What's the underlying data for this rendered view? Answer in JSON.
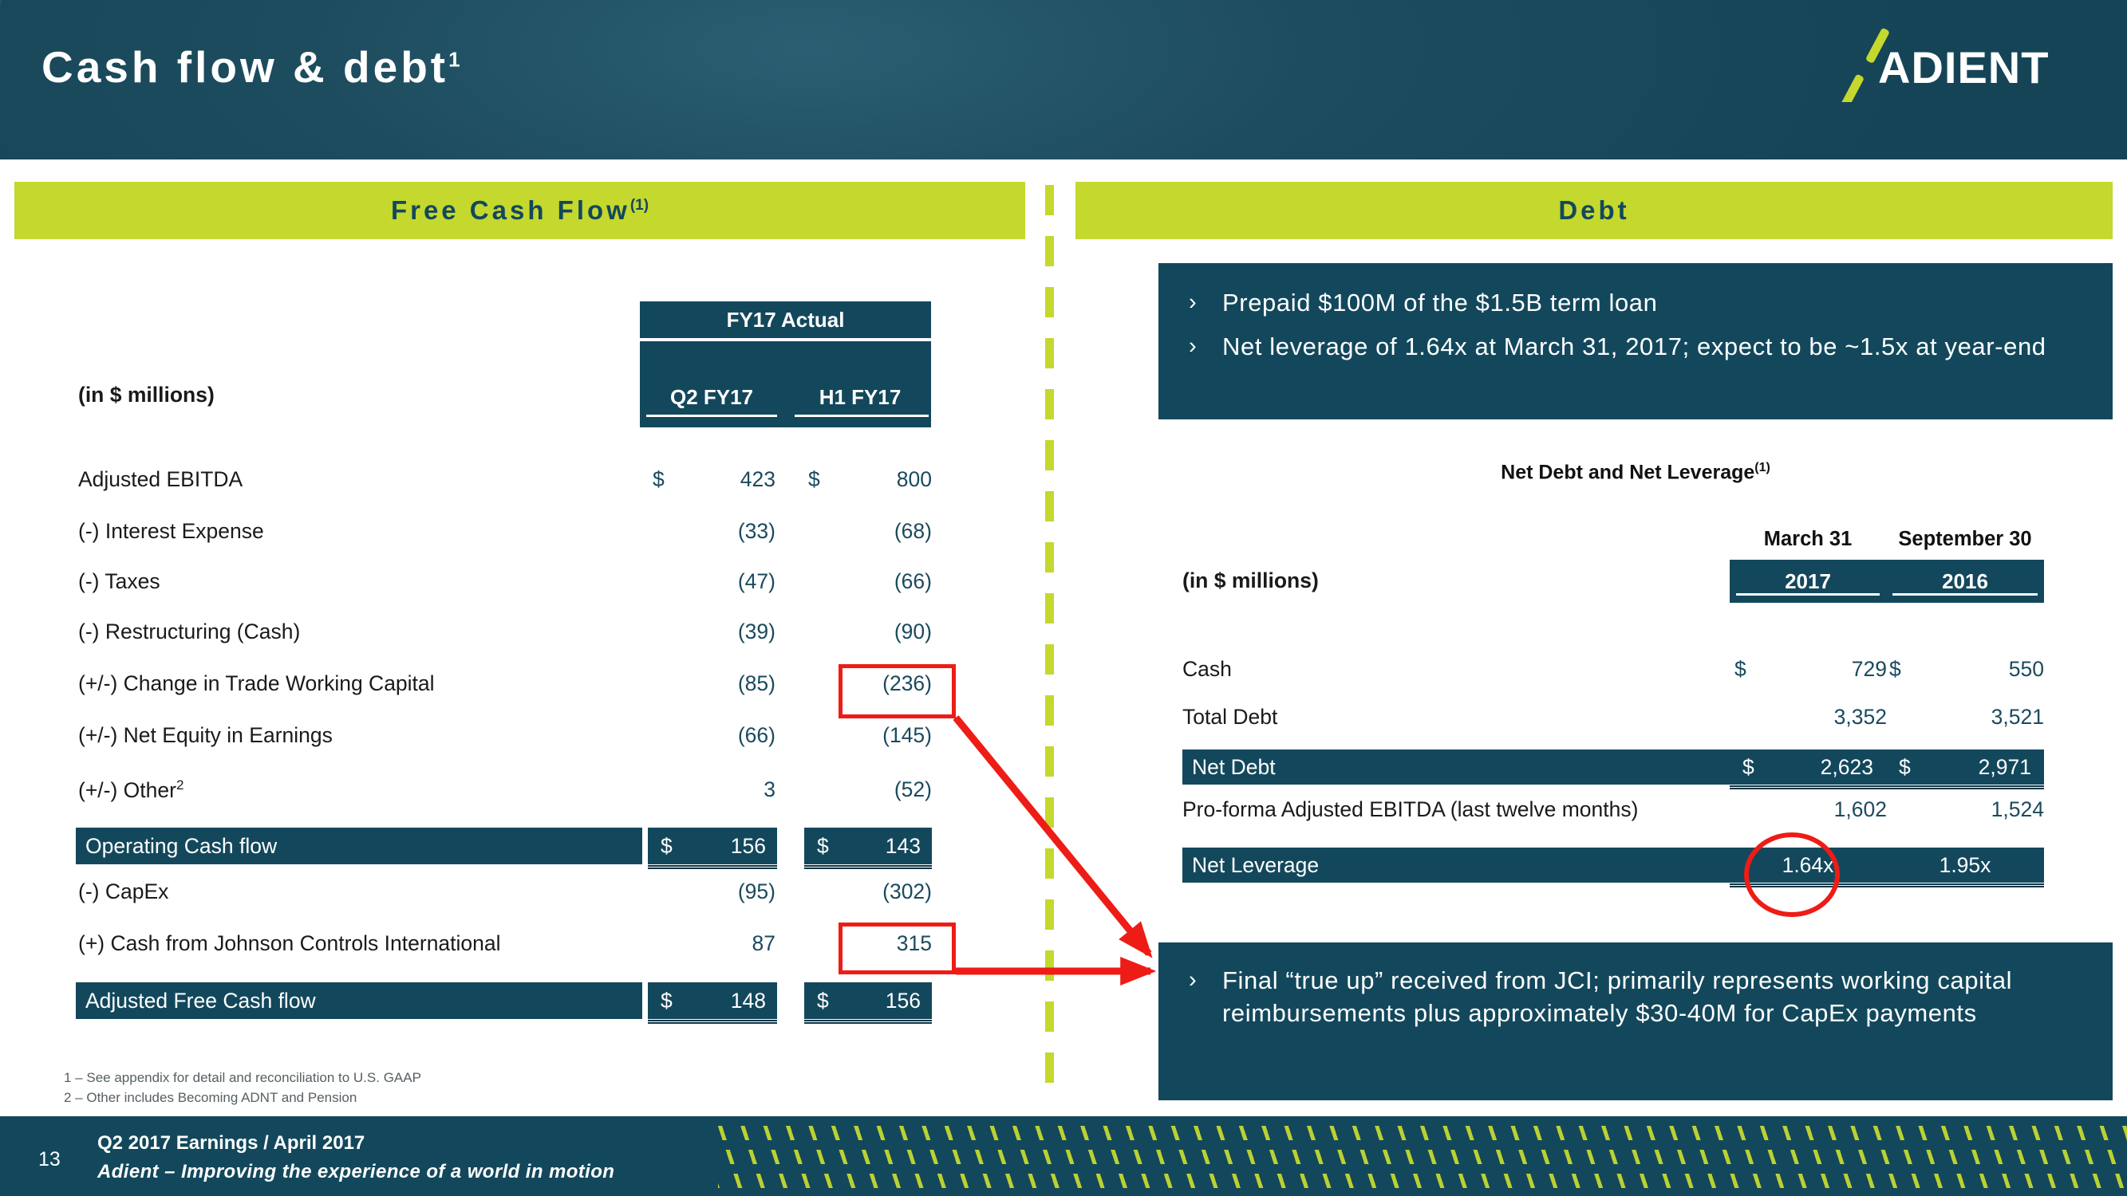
{
  "header": {
    "title": "Cash flow & debt",
    "title_sup": "1",
    "logo_text": "ADIENT"
  },
  "left_panel": {
    "bar_title": "Free Cash Flow",
    "bar_title_sup": "(1)",
    "table": {
      "group_header": "FY17 Actual",
      "column_headers": [
        "Q2 FY17",
        "H1 FY17"
      ],
      "units_label": "(in $ millions)",
      "rows": [
        {
          "label": "Adjusted EBITDA",
          "q2_dollar": "$",
          "q2": "423",
          "h1_dollar": "$",
          "h1": "800",
          "highlight": false
        },
        {
          "label": "(-) Interest Expense",
          "q2_dollar": "",
          "q2": "(33)",
          "h1_dollar": "",
          "h1": "(68)",
          "highlight": false
        },
        {
          "label": "(-) Taxes",
          "q2_dollar": "",
          "q2": "(47)",
          "h1_dollar": "",
          "h1": "(66)",
          "highlight": false
        },
        {
          "label": "(-) Restructuring (Cash)",
          "q2_dollar": "",
          "q2": "(39)",
          "h1_dollar": "",
          "h1": "(90)",
          "highlight": false
        },
        {
          "label": "(+/-) Change in Trade Working Capital",
          "q2_dollar": "",
          "q2": "(85)",
          "h1_dollar": "",
          "h1": "(236)",
          "highlight": false
        },
        {
          "label": "(+/-) Net Equity in Earnings",
          "q2_dollar": "",
          "q2": "(66)",
          "h1_dollar": "",
          "h1": "(145)",
          "highlight": false
        },
        {
          "label": "(+/-) Other",
          "label_sup": "2",
          "q2_dollar": "",
          "q2": "3",
          "h1_dollar": "",
          "h1": "(52)",
          "highlight": false
        },
        {
          "label": "Operating Cash flow",
          "q2_dollar": "$",
          "q2": "156",
          "h1_dollar": "$",
          "h1": "143",
          "highlight": true
        },
        {
          "label": "(-) CapEx",
          "q2_dollar": "",
          "q2": "(95)",
          "h1_dollar": "",
          "h1": "(302)",
          "highlight": false
        },
        {
          "label": "(+) Cash from Johnson Controls International",
          "q2_dollar": "",
          "q2": "87",
          "h1_dollar": "",
          "h1": "315",
          "highlight": false
        },
        {
          "label": "Adjusted Free Cash flow",
          "q2_dollar": "$",
          "q2": "148",
          "h1_dollar": "$",
          "h1": "156",
          "highlight": true
        }
      ]
    },
    "footnotes": [
      "1 – See appendix for detail and reconciliation to U.S. GAAP",
      "2 – Other includes Becoming ADNT and Pension"
    ]
  },
  "right_panel": {
    "bar_title": "Debt",
    "top_bullets": [
      "Prepaid $100M of the $1.5B term loan",
      "Net leverage of 1.64x at March 31, 2017; expect to be ~1.5x at year-end"
    ],
    "table_title": "Net Debt and Net Leverage",
    "table_title_sup": "(1)",
    "table": {
      "units_label": "(in $ millions)",
      "column_headers": [
        {
          "top": "March 31",
          "bottom": "2017"
        },
        {
          "top": "September 30",
          "bottom": "2016"
        }
      ],
      "rows": [
        {
          "label": "Cash",
          "c1_dollar": "$",
          "c1": "729",
          "c2_dollar": "$",
          "c2": "550",
          "highlight": false
        },
        {
          "label": "Total Debt",
          "c1_dollar": "",
          "c1": "3,352",
          "c2_dollar": "",
          "c2": "3,521",
          "highlight": false
        },
        {
          "label": "Net Debt",
          "c1_dollar": "$",
          "c1": "2,623",
          "c2_dollar": "$",
          "c2": "2,971",
          "highlight": true
        },
        {
          "label": "Pro-forma Adjusted EBITDA (last twelve months)",
          "c1_dollar": "",
          "c1": "1,602",
          "c2_dollar": "",
          "c2": "1,524",
          "highlight": false
        },
        {
          "label": "Net Leverage",
          "c1_dollar": "",
          "c1": "1.64x",
          "c2_dollar": "",
          "c2": "1.95x",
          "highlight": true,
          "centered": true
        }
      ]
    },
    "bottom_bullets": [
      "Final “true up” received from JCI; primarily represents working capital reimbursements plus approximately $30-40M for CapEx payments"
    ]
  },
  "footer": {
    "page_number": "13",
    "line1": "Q2 2017 Earnings / April 2017",
    "line2": "Adient – Improving the experience of a world in motion"
  },
  "colors": {
    "dark_teal": "#13485c",
    "lime": "#c4d82e",
    "red": "#ee1c16",
    "number_blue": "#1b4a5e"
  }
}
